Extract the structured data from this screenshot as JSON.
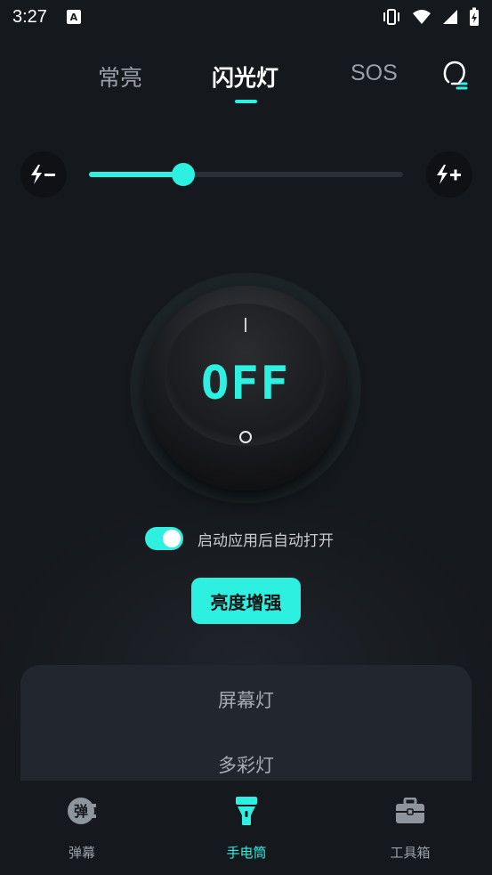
{
  "status": {
    "time": "3:27",
    "notification_letter": "A"
  },
  "tabs": [
    {
      "label": "常亮",
      "active": false
    },
    {
      "label": "闪光灯",
      "active": true
    },
    {
      "label": "SOS",
      "active": false
    }
  ],
  "slider": {
    "value_fraction": 0.3,
    "decrease_icon": "flash-minus-icon",
    "increase_icon": "flash-plus-icon"
  },
  "power_knob": {
    "state": "OFF",
    "on_mark": "I",
    "off_mark": "O"
  },
  "auto_open": {
    "label": "启动应用后自动打开",
    "enabled": true
  },
  "boost_button": {
    "label": "亮度增强"
  },
  "sheet": {
    "items": [
      "屏幕灯",
      "多彩灯"
    ]
  },
  "bottom_nav": [
    {
      "label": "弹幕",
      "icon_text": "弹",
      "active": false
    },
    {
      "label": "手电筒",
      "active": true
    },
    {
      "label": "工具箱",
      "active": false
    }
  ],
  "colors": {
    "accent": "#2ef0e0",
    "background": "#15181d",
    "sheet": "#22262f"
  }
}
